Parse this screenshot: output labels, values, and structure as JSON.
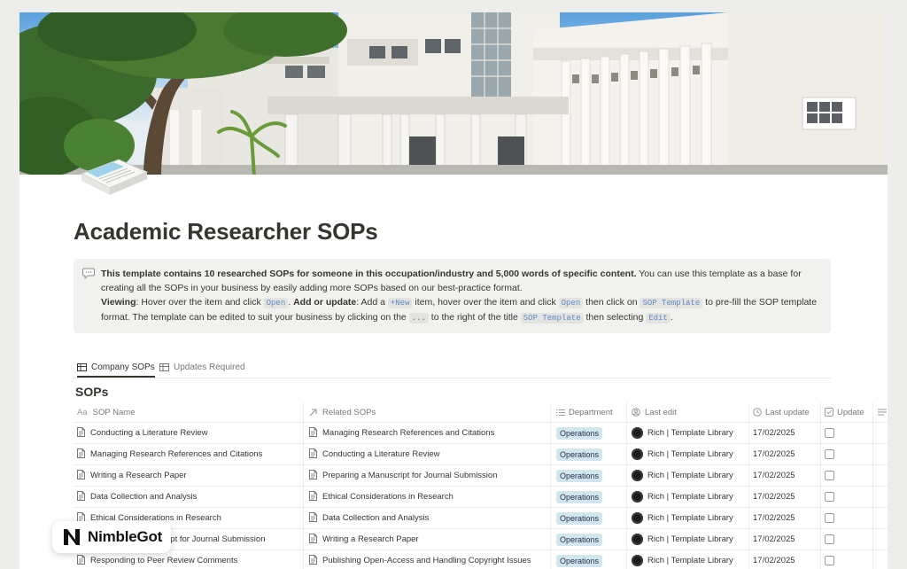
{
  "page": {
    "title": "Academic Researcher SOPs"
  },
  "callout": {
    "line1_bold": "This template contains 10 researched SOPs for someone in this occupation/industry and 5,000 words of specific content.",
    "line1_rest": " You can use this template as a base for creating all the SOPs in your business by easily adding more SOPs based on our best-practice format.",
    "viewing_label": "Viewing",
    "viewing_text": ": Hover over the item and click ",
    "code_open": "Open",
    "period": ". ",
    "add_label": "Add or update",
    "add_text": ": Add a ",
    "code_new": "+New",
    "add_text2": " item, hover over the item and click ",
    "code_open2": "Open",
    "add_text3": " then click on ",
    "code_sop_template": "SOP Template",
    "add_text4": " to pre-fill the SOP template format. The template can be edited to suit your business by clicking on the ",
    "code_dots": "...",
    "add_text5": " to the right of the title ",
    "code_sop_template2": "SOP Template",
    "add_text6": " then selecting ",
    "code_edit": "Edit",
    "end": "."
  },
  "tabs": [
    {
      "label": "Company SOPs",
      "active": true
    },
    {
      "label": "Updates Required",
      "active": false
    }
  ],
  "database": {
    "title": "SOPs",
    "columns": {
      "name": "SOP Name",
      "name_prefix": "Aa",
      "related": "Related SOPs",
      "department": "Department",
      "last_edit": "Last edit",
      "last_update": "Last update",
      "update": "Update"
    },
    "rows": [
      {
        "name": "Conducting a Literature Review",
        "related": "Managing Research References and Citations",
        "department": "Operations",
        "editor": "Rich | Template Library",
        "date": "17/02/2025"
      },
      {
        "name": "Managing Research References and Citations",
        "related": "Conducting a Literature Review",
        "department": "Operations",
        "editor": "Rich | Template Library",
        "date": "17/02/2025"
      },
      {
        "name": "Writing a Research Paper",
        "related": "Preparing a Manuscript for Journal Submission",
        "department": "Operations",
        "editor": "Rich | Template Library",
        "date": "17/02/2025"
      },
      {
        "name": "Data Collection and Analysis",
        "related": "Ethical Considerations in Research",
        "department": "Operations",
        "editor": "Rich | Template Library",
        "date": "17/02/2025"
      },
      {
        "name": "Ethical Considerations in Research",
        "related": "Data Collection and Analysis",
        "department": "Operations",
        "editor": "Rich | Template Library",
        "date": "17/02/2025"
      },
      {
        "name": "Preparing a Manuscript for Journal Submission",
        "related": "Writing a Research Paper",
        "department": "Operations",
        "editor": "Rich | Template Library",
        "date": "17/02/2025"
      },
      {
        "name": "Responding to Peer Review Comments",
        "related": "Publishing Open-Access and Handling Copyright Issues",
        "department": "Operations",
        "editor": "Rich | Template Library",
        "date": "17/02/2025"
      }
    ]
  },
  "logo": {
    "text": "NimbleGot",
    "mark": "N"
  },
  "colors": {
    "badge_bg": "#d3e5ef",
    "code_text": "#5f87c8",
    "callout_bg": "#f1f1ef"
  },
  "icons": {
    "callout": "speech-bubble-icon",
    "tab_table": "table-icon",
    "row": "document-icon"
  }
}
